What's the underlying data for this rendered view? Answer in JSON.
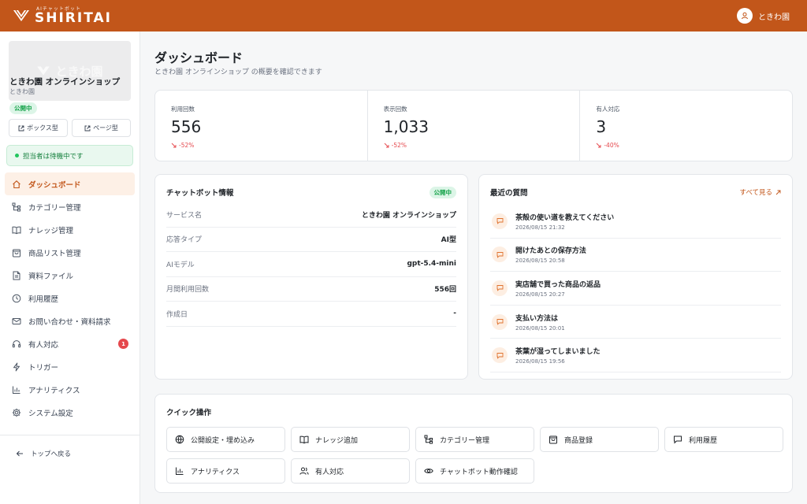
{
  "header": {
    "logo_sub": "AIチャットボット",
    "logo_main": "SHIRITAI",
    "user_name": "ときわ園"
  },
  "sidebar": {
    "thumb_text": "ときわ園",
    "shop_name": "ときわ園 オンラインショップ",
    "shop_sub": "ときわ園",
    "shop_status": "公開中",
    "box_type_label": "ボックス型",
    "page_type_label": "ページ型",
    "staff_status": "担当者は待機中です",
    "items": [
      {
        "label": "ダッシュボード",
        "icon": "home-icon",
        "active": true
      },
      {
        "label": "カテゴリー管理",
        "icon": "category-tree-icon"
      },
      {
        "label": "ナレッジ管理",
        "icon": "book-open-icon"
      },
      {
        "label": "商品リスト管理",
        "icon": "shopping-bag-icon"
      },
      {
        "label": "資料ファイル",
        "icon": "file-text-icon"
      },
      {
        "label": "利用履歴",
        "icon": "clock-icon"
      },
      {
        "label": "お問い合わせ・資料請求",
        "icon": "mail-icon"
      },
      {
        "label": "有人対応",
        "icon": "headset-icon",
        "count": "1"
      },
      {
        "label": "トリガー",
        "icon": "lightning-icon"
      },
      {
        "label": "アナリティクス",
        "icon": "bar-chart-icon"
      },
      {
        "label": "システム設定",
        "icon": "gear-icon"
      }
    ],
    "back_label": "トップへ戻る"
  },
  "page": {
    "title": "ダッシュボード",
    "subtitle": "ときわ園 オンラインショップ の概要を確認できます"
  },
  "stats": [
    {
      "label": "利用回数",
      "value": "556",
      "delta": "-52%"
    },
    {
      "label": "表示回数",
      "value": "1,033",
      "delta": "-52%"
    },
    {
      "label": "有人対応",
      "value": "3",
      "delta": "-40%"
    }
  ],
  "chatbot_info": {
    "title": "チャットボット情報",
    "status": "公開中",
    "rows": [
      {
        "key": "サービス名",
        "value": "ときわ園 オンラインショップ"
      },
      {
        "key": "応答タイプ",
        "value": "AI型"
      },
      {
        "key": "AIモデル",
        "value": "gpt-5.4-mini"
      },
      {
        "key": "月間利用回数",
        "value": "556回"
      },
      {
        "key": "作成日",
        "value": "-"
      }
    ]
  },
  "recent_questions": {
    "title": "最近の質問",
    "see_all": "すべて見る",
    "items": [
      {
        "title": "茶殻の使い道を教えてください",
        "time": "2026/08/15 21:32"
      },
      {
        "title": "開けたあとの保存方法",
        "time": "2026/08/15 20:58"
      },
      {
        "title": "実店舗で買った商品の返品",
        "time": "2026/08/15 20:27"
      },
      {
        "title": "支払い方法は",
        "time": "2026/08/15 20:01"
      },
      {
        "title": "茶葉が湿ってしまいました",
        "time": "2026/08/15 19:56"
      }
    ]
  },
  "quick_actions": {
    "title": "クイック操作",
    "items": [
      {
        "label": "公開設定・埋め込み",
        "icon": "globe-icon"
      },
      {
        "label": "ナレッジ追加",
        "icon": "book-open-icon"
      },
      {
        "label": "カテゴリー管理",
        "icon": "category-tree-icon"
      },
      {
        "label": "商品登録",
        "icon": "shopping-bag-icon"
      },
      {
        "label": "利用履歴",
        "icon": "chat-bubble-icon"
      },
      {
        "label": "アナリティクス",
        "icon": "bar-chart-icon"
      },
      {
        "label": "有人対応",
        "icon": "users-icon"
      },
      {
        "label": "チャットボット動作確認",
        "icon": "eye-icon"
      }
    ]
  },
  "colors": {
    "brand": "#c2561a",
    "success": "#16a34a",
    "danger": "#e5484d"
  }
}
